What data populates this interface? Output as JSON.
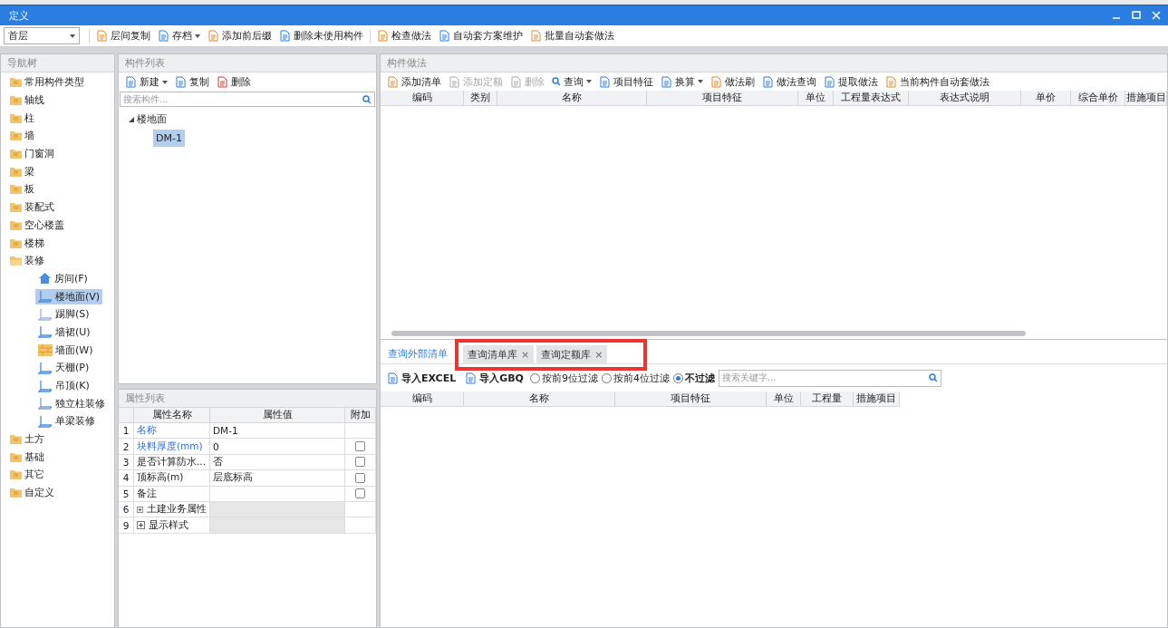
{
  "window": {
    "title": "定义"
  },
  "toolbar": {
    "floor_select": {
      "value": "首层"
    },
    "buttons": [
      {
        "label": "层间复制",
        "dropdown": false
      },
      {
        "label": "存档",
        "dropdown": true
      },
      {
        "label": "添加前后缀",
        "dropdown": false
      },
      {
        "label": "删除未使用构件",
        "dropdown": false
      },
      {
        "label": "检查做法",
        "dropdown": false
      },
      {
        "label": "自动套方案维护",
        "dropdown": false
      },
      {
        "label": "批量自动套做法",
        "dropdown": false
      }
    ]
  },
  "nav_tree": {
    "title": "导航树",
    "items": [
      {
        "label": "常用构件类型",
        "expanded": false
      },
      {
        "label": "轴线",
        "expanded": false
      },
      {
        "label": "柱",
        "expanded": false
      },
      {
        "label": "墙",
        "expanded": false
      },
      {
        "label": "门窗洞",
        "expanded": false
      },
      {
        "label": "梁",
        "expanded": false
      },
      {
        "label": "板",
        "expanded": false
      },
      {
        "label": "装配式",
        "expanded": false
      },
      {
        "label": "空心楼盖",
        "expanded": false
      },
      {
        "label": "楼梯",
        "expanded": false
      },
      {
        "label": "装修",
        "expanded": true,
        "children": [
          {
            "label": "房间(F)",
            "selected": false
          },
          {
            "label": "楼地面(V)",
            "selected": true
          },
          {
            "label": "踢脚(S)",
            "selected": false
          },
          {
            "label": "墙裙(U)",
            "selected": false
          },
          {
            "label": "墙面(W)",
            "selected": false
          },
          {
            "label": "天棚(P)",
            "selected": false
          },
          {
            "label": "吊顶(K)",
            "selected": false
          },
          {
            "label": "独立柱装修",
            "selected": false
          },
          {
            "label": "单梁装修",
            "selected": false
          }
        ]
      },
      {
        "label": "土方",
        "expanded": false
      },
      {
        "label": "基础",
        "expanded": false
      },
      {
        "label": "其它",
        "expanded": false
      },
      {
        "label": "自定义",
        "expanded": false
      }
    ]
  },
  "component_list": {
    "title": "构件列表",
    "buttons": [
      {
        "label": "新建",
        "dropdown": true
      },
      {
        "label": "复制",
        "dropdown": false
      },
      {
        "label": "删除",
        "dropdown": false
      }
    ],
    "search": {
      "placeholder": "搜索构件..."
    },
    "tree": [
      {
        "label": "楼地面",
        "expanded": true,
        "children": [
          {
            "label": "DM-1",
            "selected": true
          }
        ]
      }
    ]
  },
  "properties": {
    "title": "属性列表",
    "columns": [
      "属性名称",
      "属性值",
      "附加"
    ],
    "rows": [
      {
        "index": "1",
        "name": "名称",
        "value": "DM-1",
        "kind": "primary",
        "attachable": false
      },
      {
        "index": "2",
        "name": "块料厚度(mm)",
        "value": "0",
        "kind": "primary",
        "attachable": true,
        "checked": false
      },
      {
        "index": "3",
        "name": "是否计算防水...",
        "value": "否",
        "kind": "plain",
        "attachable": true,
        "checked": false
      },
      {
        "index": "4",
        "name": "顶标高(m)",
        "value": "层底标高",
        "kind": "plain",
        "attachable": true,
        "checked": false
      },
      {
        "index": "5",
        "name": "备注",
        "kind": "plain",
        "attachable": true,
        "checked": false
      },
      {
        "index": "6",
        "name": "土建业务属性",
        "kind": "group",
        "attachable": false
      },
      {
        "index": "9",
        "name": "显示样式",
        "kind": "group",
        "attachable": false
      }
    ]
  },
  "method_panel": {
    "title": "构件做法",
    "buttons": [
      {
        "label": "添加清单",
        "disabled": false,
        "dropdown": false
      },
      {
        "label": "添加定额",
        "disabled": true,
        "dropdown": false
      },
      {
        "label": "删除",
        "disabled": true,
        "dropdown": false
      },
      {
        "label": "查询",
        "disabled": false,
        "dropdown": true
      },
      {
        "label": "项目特征",
        "disabled": false,
        "dropdown": false
      },
      {
        "label": "换算",
        "disabled": false,
        "dropdown": true
      },
      {
        "label": "做法刷",
        "disabled": false,
        "dropdown": false
      },
      {
        "label": "做法查询",
        "disabled": false,
        "dropdown": false
      },
      {
        "label": "提取做法",
        "disabled": false,
        "dropdown": false
      },
      {
        "label": "当前构件自动套做法",
        "disabled": false,
        "dropdown": false
      }
    ],
    "columns": [
      "编码",
      "类别",
      "名称",
      "项目特征",
      "单位",
      "工程量表达式",
      "表达式说明",
      "单价",
      "综合单价",
      "措施项目"
    ]
  },
  "query_panel": {
    "tabs": [
      {
        "label": "查询外部清单",
        "selected": true,
        "closable": false,
        "highlighted": false
      },
      {
        "label": "查询清单库",
        "selected": false,
        "closable": true,
        "highlighted": true
      },
      {
        "label": "查询定额库",
        "selected": false,
        "closable": true,
        "highlighted": true
      }
    ],
    "close_glyph": "×",
    "imports": [
      {
        "label": "导入EXCEL"
      },
      {
        "label": "导入GBQ"
      }
    ],
    "filters": [
      {
        "label": "按前9位过滤",
        "selected": false
      },
      {
        "label": "按前4位过滤",
        "selected": false
      },
      {
        "label": "不过滤",
        "selected": true
      }
    ],
    "search": {
      "placeholder": "搜索关键字..."
    },
    "columns": [
      "编码",
      "名称",
      "项目特征",
      "单位",
      "工程量",
      "措施项目"
    ]
  }
}
